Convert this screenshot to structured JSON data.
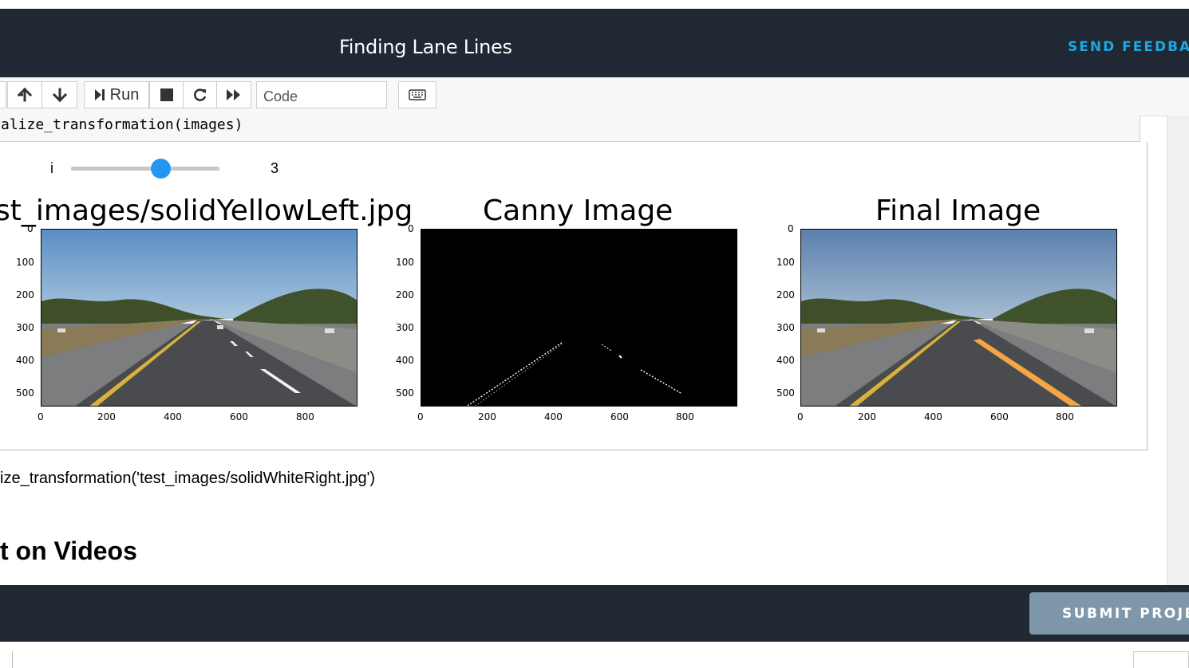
{
  "header": {
    "title": "Finding Lane Lines",
    "feedback_label": "SEND FEEDBA"
  },
  "toolbar": {
    "run_label": "Run",
    "cell_type": "Code"
  },
  "cell": {
    "code": "alize_transformation(images)"
  },
  "widget": {
    "label": "i",
    "value": "3",
    "level": 0.6
  },
  "plots": [
    {
      "title": "st_images/solidYellowLeft.jpg",
      "yticks": [
        "0",
        "100",
        "200",
        "300",
        "400",
        "500"
      ],
      "xticks": [
        "0",
        "200",
        "400",
        "600",
        "800"
      ]
    },
    {
      "title": "Canny Image",
      "yticks": [
        "0",
        "100",
        "200",
        "300",
        "400",
        "500"
      ],
      "xticks": [
        "0",
        "200",
        "400",
        "600",
        "800"
      ]
    },
    {
      "title": "Final Image",
      "yticks": [
        "0",
        "100",
        "200",
        "300",
        "400",
        "500"
      ],
      "xticks": [
        "0",
        "200",
        "400",
        "600",
        "800"
      ]
    }
  ],
  "markdown": {
    "code_text": "ize_transformation('test_images/solidWhiteRight.jpg')",
    "heading": "t on Videos"
  },
  "footer": {
    "submit_label": "SUBMIT PROJE"
  },
  "colors": {
    "header_bg": "#1f2833",
    "accent": "#1fa7e1",
    "slider": "#2196f3",
    "submit_bg": "#7f97aa"
  }
}
